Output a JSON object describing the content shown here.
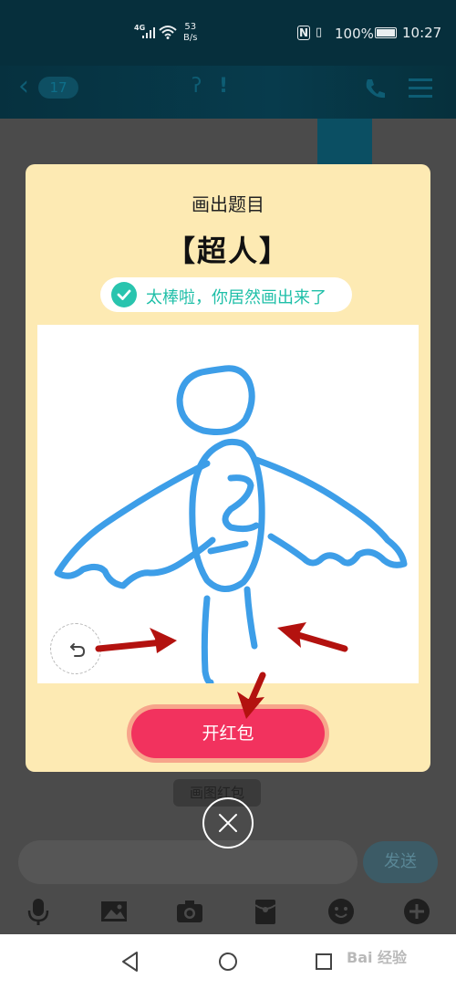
{
  "status_bar": {
    "network": "4G",
    "speed_value": "53",
    "speed_unit": "B/s",
    "nfc": "N",
    "battery": "100%",
    "time": "10:27"
  },
  "nav": {
    "back_count": "17",
    "icons": [
      "chevron-left-icon",
      "ear-icon",
      "exclamation-icon",
      "phone-icon",
      "menu-icon"
    ]
  },
  "modal": {
    "title": "画出题目",
    "topic": "【超人】",
    "success_text": "太棒啦，你居然画出来了",
    "open_button": "开红包"
  },
  "background": {
    "label": "画图红包",
    "send_button": "发送",
    "toolbar_icons": [
      "mic-icon",
      "image-icon",
      "camera-icon",
      "red-packet-icon",
      "emoji-icon",
      "plus-icon"
    ]
  },
  "watermark": "Bai 经验",
  "colors": {
    "modal_bg": "#fdeab3",
    "accent_red": "#f2325e",
    "success_teal": "#29c4ae",
    "stroke_blue": "#3d9ee8",
    "arrow_red": "#b3120f"
  }
}
